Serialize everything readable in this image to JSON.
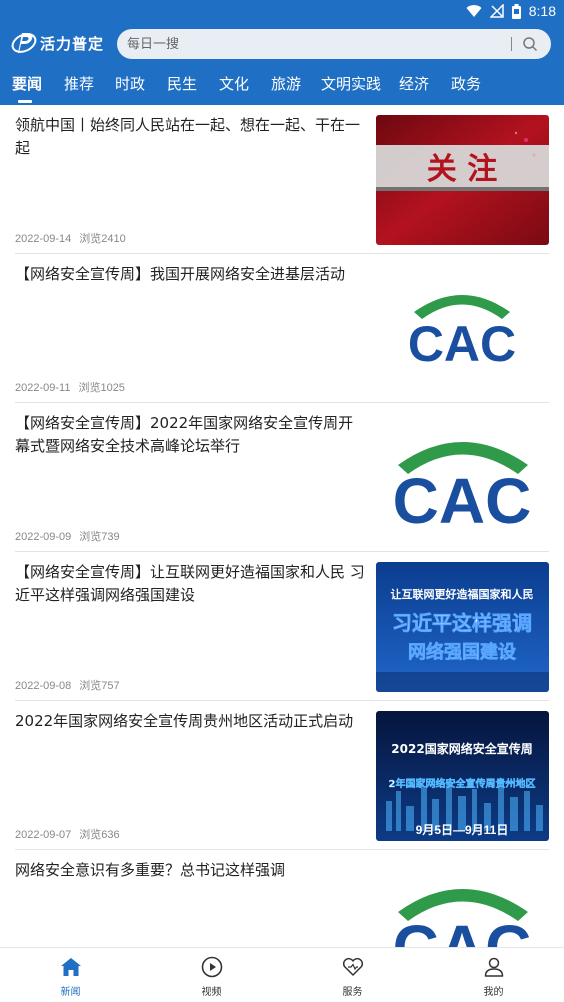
{
  "status_bar": {
    "time": "8:18"
  },
  "header": {
    "app_name": "活力普定",
    "search": {
      "placeholder": "每日一搜"
    }
  },
  "tabs": [
    {
      "label": "要闻",
      "active": true
    },
    {
      "label": "推荐"
    },
    {
      "label": "时政"
    },
    {
      "label": "民生"
    },
    {
      "label": "文化"
    },
    {
      "label": "旅游"
    },
    {
      "label": "文明实践"
    },
    {
      "label": "经济"
    },
    {
      "label": "政务"
    }
  ],
  "news": [
    {
      "title": "领航中国丨始终同人民站在一起、想在一起、干在一起",
      "date": "2022-09-14",
      "views": "浏览2410",
      "thumb_text": "关 注"
    },
    {
      "title": "【网络安全宣传周】我国开展网络安全进基层活动",
      "date": "2022-09-11",
      "views": "浏览1025",
      "thumb_text": "CAC"
    },
    {
      "title": "【网络安全宣传周】2022年国家网络安全宣传周开幕式暨网络安全技术高峰论坛举行",
      "date": "2022-09-09",
      "views": "浏览739",
      "thumb_text": "CAC"
    },
    {
      "title": "【网络安全宣传周】让互联网更好造福国家和人民 习近平这样强调网络强国建设",
      "date": "2022-09-08",
      "views": "浏览757",
      "thumb_lines": [
        "让互联网更好造福国家和人民",
        "习近平这样强调",
        "网络强国建设"
      ]
    },
    {
      "title": "2022年国家网络安全宣传周贵州地区活动正式启动",
      "date": "2022-09-07",
      "views": "浏览636",
      "thumb_lines": [
        "2022国家网络安全宣传周",
        "2年国家网络安全宣传周贵州地区",
        "9月5日—9月11日"
      ]
    },
    {
      "title": "网络安全意识有多重要？总书记这样强调",
      "thumb_text": "CAC"
    }
  ],
  "bottom_nav": [
    {
      "label": "新闻",
      "icon": "home-icon",
      "active": true
    },
    {
      "label": "视频",
      "icon": "play-icon"
    },
    {
      "label": "服务",
      "icon": "heart-icon"
    },
    {
      "label": "我的",
      "icon": "user-icon"
    }
  ],
  "colors": {
    "brand": "#1f6fc4",
    "cac_blue": "#1a4fa0",
    "cac_green": "#2e9a4a",
    "banner_red": "#b3121f"
  }
}
